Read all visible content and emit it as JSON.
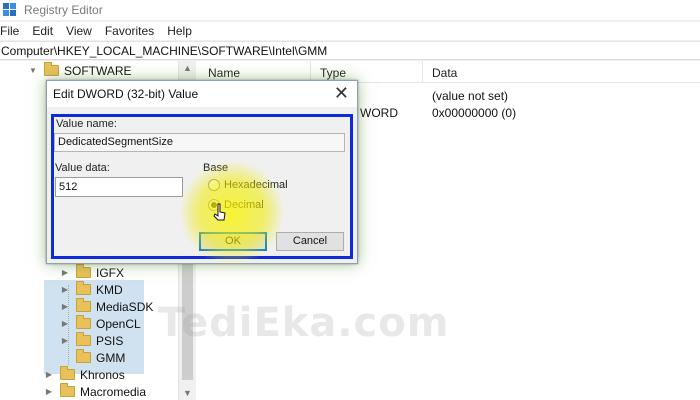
{
  "window": {
    "title": "Registry Editor"
  },
  "menu": [
    "File",
    "Edit",
    "View",
    "Favorites",
    "Help"
  ],
  "address": "Computer\\HKEY_LOCAL_MACHINE\\SOFTWARE\\Intel\\GMM",
  "tree": {
    "software": "SOFTWARE",
    "children": [
      {
        "label": "IGFX"
      },
      {
        "label": "KMD"
      },
      {
        "label": "MediaSDK"
      },
      {
        "label": "OpenCL"
      },
      {
        "label": "PSIS"
      },
      {
        "label": "GMM"
      }
    ],
    "khronos": "Khronos",
    "macromedia": "Macromedia"
  },
  "list": {
    "columns": {
      "name": "Name",
      "type": "Type",
      "data": "Data"
    },
    "rows": [
      {
        "type": "",
        "data": "(value not set)"
      },
      {
        "type": "WORD",
        "data": "0x00000000 (0)"
      }
    ]
  },
  "dialog": {
    "title": "Edit DWORD (32-bit) Value",
    "close_glyph": "✕",
    "value_name_label": "Value name:",
    "value_name": "DedicatedSegmentSize",
    "value_data_label": "Value data:",
    "value_data": "512",
    "base_label": "Base",
    "hex_label": "Hexadecimal",
    "dec_label": "Decimal",
    "selected_base": "Decimal",
    "ok_label": "OK",
    "cancel_label": "Cancel"
  },
  "watermark": "TediEka.com",
  "colors": {
    "frame": "#0d2bd8",
    "highlight": "#f5f000",
    "default_button": "#0078d7"
  }
}
